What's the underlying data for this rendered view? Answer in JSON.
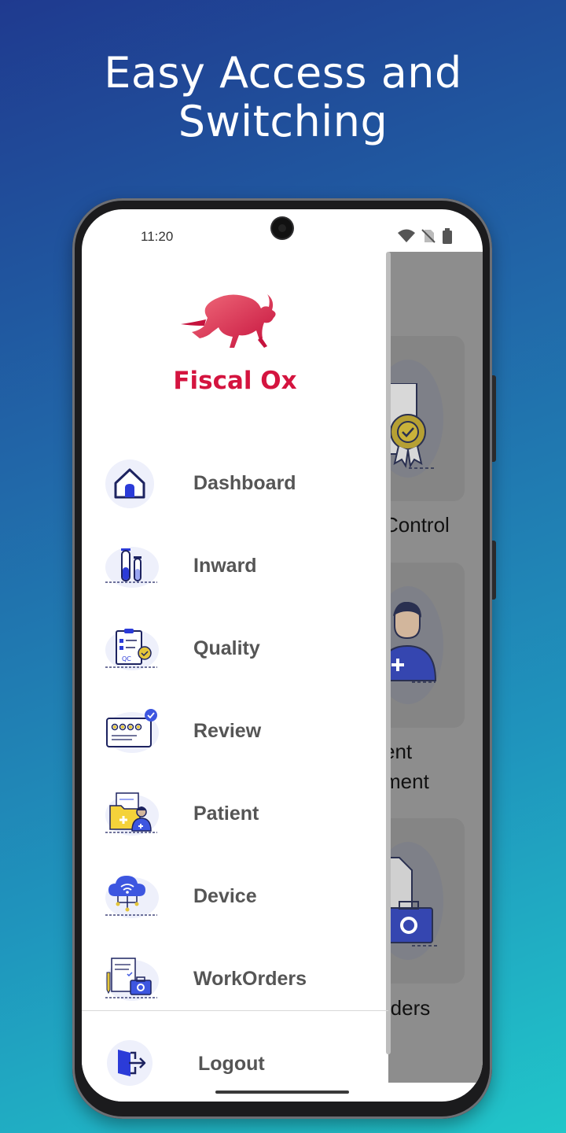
{
  "headline": {
    "line1": "Easy Access and",
    "line2": "Switching"
  },
  "status_bar": {
    "time": "11:20",
    "icons": [
      "wifi-icon",
      "no-sim-icon",
      "battery-icon"
    ]
  },
  "brand": {
    "name": "Fiscal Ox",
    "color": "#d4143f"
  },
  "menu": [
    {
      "label": "Dashboard",
      "icon": "home-icon"
    },
    {
      "label": "Inward",
      "icon": "test-tubes-icon"
    },
    {
      "label": "Quality",
      "icon": "qc-clipboard-icon"
    },
    {
      "label": "Review",
      "icon": "review-chat-icon"
    },
    {
      "label": "Patient",
      "icon": "patient-folder-icon"
    },
    {
      "label": "Device",
      "icon": "cloud-device-icon"
    },
    {
      "label": "WorkOrders",
      "icon": "workorder-toolbox-icon"
    }
  ],
  "logout": {
    "label": "Logout",
    "icon": "logout-icon"
  },
  "background_screen": {
    "labels": [
      "Control",
      "ent",
      "ment",
      "rders"
    ]
  }
}
